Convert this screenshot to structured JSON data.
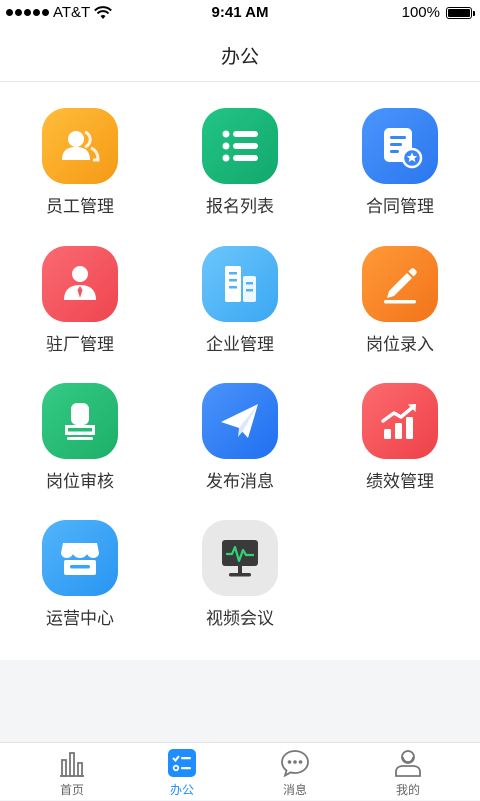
{
  "status_bar": {
    "carrier": "AT&T",
    "time": "9:41 AM",
    "battery": "100%"
  },
  "nav": {
    "title": "办公"
  },
  "grid": [
    {
      "label": "员工管理",
      "icon": "staff-icon",
      "color": "#f8a623"
    },
    {
      "label": "报名列表",
      "icon": "list-icon",
      "color": "#19b47a"
    },
    {
      "label": "合同管理",
      "icon": "contract-icon",
      "color": "#3b86f6"
    },
    {
      "label": "驻厂管理",
      "icon": "resident-icon",
      "color": "#f25560"
    },
    {
      "label": "企业管理",
      "icon": "building-icon",
      "color": "#4fb3f6"
    },
    {
      "label": "岗位录入",
      "icon": "pencil-icon",
      "color": "#f98220"
    },
    {
      "label": "岗位审核",
      "icon": "stamp-icon",
      "color": "#23bd75"
    },
    {
      "label": "发布消息",
      "icon": "paper-plane-icon",
      "color": "#2f7ef5"
    },
    {
      "label": "绩效管理",
      "icon": "growth-chart-icon",
      "color": "#f5535a"
    },
    {
      "label": "运营中心",
      "icon": "store-icon",
      "color": "#3aa4f7"
    },
    {
      "label": "视频会议",
      "icon": "monitor-icon",
      "color": "#e8e8e8"
    }
  ],
  "tabs": [
    {
      "label": "首页",
      "icon": "bar-chart-icon",
      "active": false
    },
    {
      "label": "办公",
      "icon": "checklist-icon",
      "active": true
    },
    {
      "label": "消息",
      "icon": "chat-bubble-icon",
      "active": false
    },
    {
      "label": "我的",
      "icon": "user-icon",
      "active": false
    }
  ],
  "colors": {
    "accent": "#1f8cff",
    "page_bg": "#f4f5f7"
  }
}
